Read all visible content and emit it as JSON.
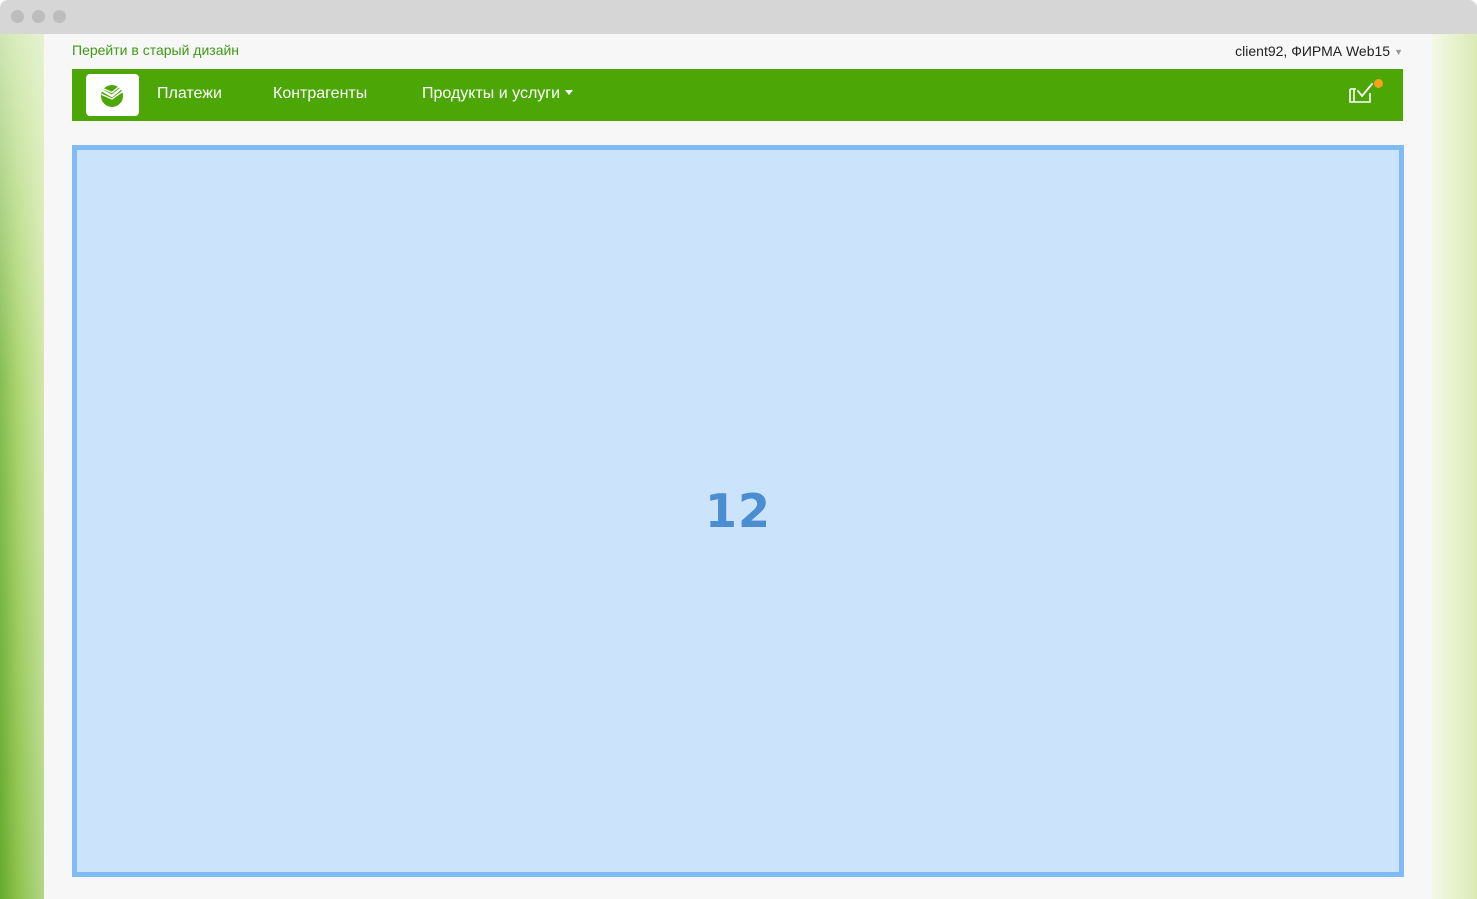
{
  "header": {
    "old_design_link": "Перейти в старый дизайн",
    "user_label": "client92, ФИРМА Web15",
    "user_caret": "▼"
  },
  "nav": {
    "items": [
      {
        "label": "Платежи"
      },
      {
        "label": "Контрагенты"
      },
      {
        "label": "Продукты и услуги"
      }
    ],
    "icons": {
      "logo": "sberbank-logo-icon",
      "mail": "mail-check-icon",
      "notification": "notification-dot-icon",
      "dropdown": "chevron-down-icon"
    }
  },
  "main": {
    "placeholder_number": "12"
  },
  "colors": {
    "brand_green": "#4ca606",
    "link_green": "#3f9a16",
    "placeholder_bg": "#cbe4fb",
    "placeholder_border": "#7fbbf5",
    "placeholder_text": "#4a8dd1",
    "notification": "#f5a21a"
  }
}
